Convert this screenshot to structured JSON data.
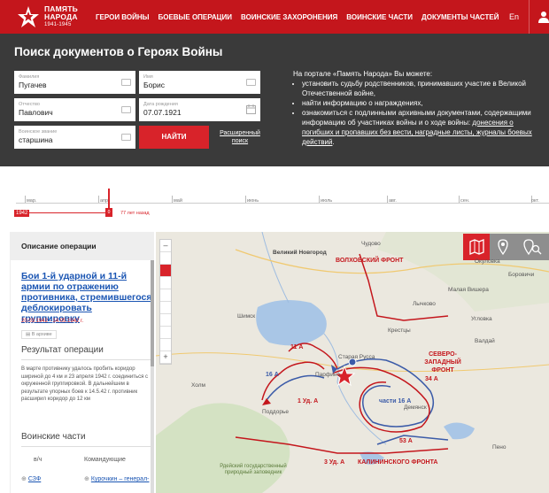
{
  "logo": {
    "line1": "ПАМЯТЬ",
    "line2": "НАРОДА",
    "years": "1941-1945"
  },
  "nav": [
    "ГЕРОИ ВОЙНЫ",
    "БОЕВЫЕ ОПЕРАЦИИ",
    "ВОИНСКИЕ ЗАХОРОНЕНИЯ",
    "ВОИНСКИЕ ЧАСТИ",
    "ДОКУМЕНТЫ ЧАСТЕЙ"
  ],
  "lang": "En",
  "search": {
    "title": "Поиск документов о Героях Войны",
    "fields": [
      {
        "label": "Фамилия",
        "value": "Пугачев"
      },
      {
        "label": "Имя",
        "value": "Борис"
      },
      {
        "label": "Отчество",
        "value": "Павлович"
      },
      {
        "label": "Дата рождения",
        "value": "07.07.1921"
      },
      {
        "label": "Воинское звание",
        "value": "старшина"
      }
    ],
    "find_button": "НАЙТИ",
    "advanced_link": "Расширенный поиск"
  },
  "info": {
    "intro": "На портале «Память Народа» Вы можете:",
    "items": [
      "установить судьбу родственников, принимавших участие в Великой Отечественной войне,",
      "найти информацию о награждениях,",
      "ознакомиться с подлинными архивными документами, содержащими информацию об участниках войны и о ходе войны:"
    ],
    "links": "донесения о погибших и пропавших без вести, наградные листы, журналы боевых действий"
  },
  "timeline": {
    "months": [
      "мар.",
      "апр.",
      "май",
      "июнь",
      "июль",
      "авг.",
      "сен.",
      "окт."
    ],
    "year": "1942",
    "cursor_label": "0",
    "ago": "77 лет назад"
  },
  "panel": {
    "header": "Описание операции",
    "op_title": "Бои 1-й ударной и 11-й армии по отражению противника, стремившегося деблокировать группировку",
    "op_dates": "20.03.1942 - 14.05.1942 г.",
    "archive_badge": "В архиве",
    "result_title": "Результат операции",
    "result_text": "В марте противнику удалось пробить коридор шириной до 4 км и 23 апреля 1942 г. соединиться с окруженной группировкой. В дальнейшем в результате упорных боев к 14.5.42 г. противник расширил коридор до 12 км",
    "units_title": "Воинские части",
    "col_unit": "в/ч",
    "col_commanders": "Командующие",
    "unit_name": "СЗФ",
    "commander": "Курочкин – генерал-"
  },
  "map": {
    "places": [
      "Великий Новгород",
      "Чудово",
      "Малая Вишера",
      "Валдай",
      "Боровичи",
      "Старая Русса",
      "Демянск",
      "Холм",
      "Шимск",
      "Парфино",
      "Лычково",
      "Крестцы",
      "Окуловка",
      "Угловка",
      "Поддорье",
      "Пено"
    ],
    "fronts": [
      "ВОЛХОВСКИЙ ФРОНТ",
      "СЕВЕРО-ЗАПАДНЫЙ ФРОНТ",
      "КАЛИНИНСКОГО ФРОНТА"
    ],
    "armies": [
      "11 А",
      "16 А",
      "1 Уд. А",
      "части 16 А",
      "34 А",
      "53 А",
      "3 Уд. А"
    ],
    "reserve": "Рдейский государственный природный заповедник",
    "colors": {
      "front": "#c4161c",
      "army_blue": "#3b5ba8",
      "army_red": "#c4161c"
    }
  }
}
